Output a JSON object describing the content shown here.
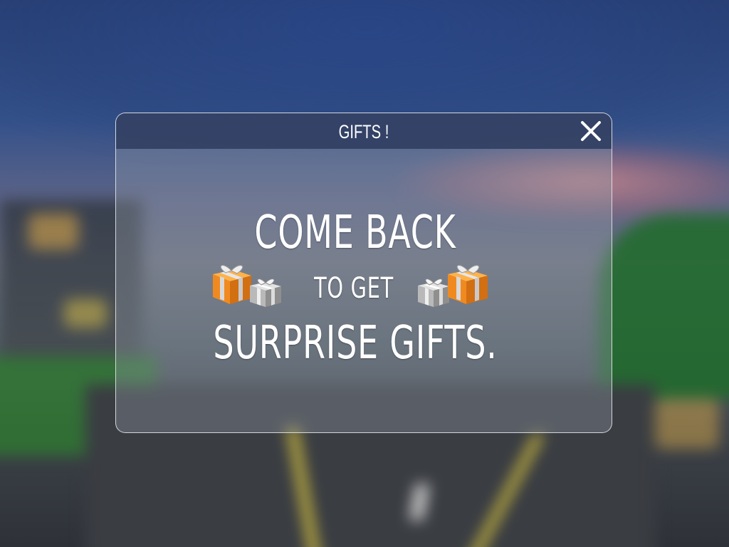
{
  "dialog": {
    "title": "GIFTS !",
    "close_label": "✕",
    "message": {
      "line1": "COME BACK",
      "line2": "TO GET",
      "line3": "SURPRISE GIFTS."
    },
    "icons": {
      "close": "close-icon",
      "gifts_left": "gift-boxes-icon",
      "gifts_right": "gift-boxes-icon"
    }
  },
  "colors": {
    "header": "#303e62",
    "text": "#ffffff",
    "gift_orange": "#f08a20",
    "gift_silver": "#b9b9b9",
    "background_sky": "#2a4278"
  }
}
